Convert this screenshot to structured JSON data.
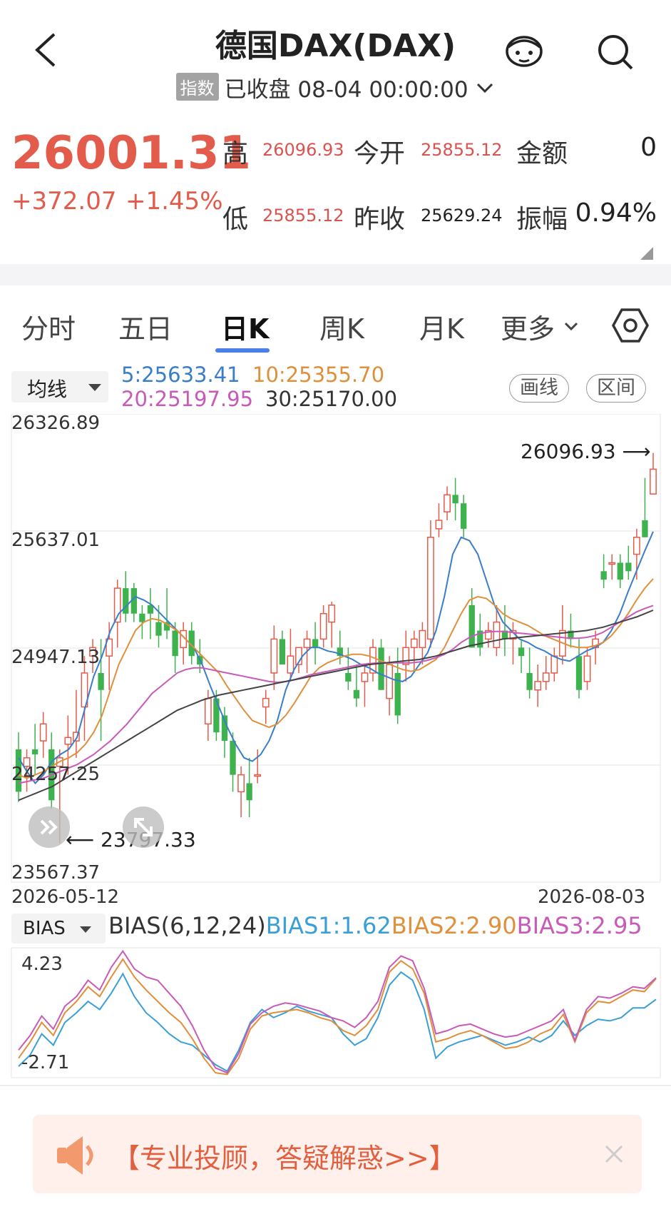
{
  "header": {
    "title": "德国DAX(DAX)",
    "tag": "指数",
    "status": "已收盘",
    "datetime": "08-04 00:00:00"
  },
  "quote": {
    "price": "26001.31",
    "change": "+372.07",
    "change_pct": "+1.45%",
    "high_label": "高",
    "high": "26096.93",
    "low_label": "低",
    "low": "25855.12",
    "open_label": "今开",
    "open": "25855.12",
    "prev_close_label": "昨收",
    "prev_close": "25629.24",
    "amount_label": "金额",
    "amount": "0",
    "amplitude_label": "振幅",
    "amplitude": "0.94%"
  },
  "tabs": [
    "分时",
    "五日",
    "日K",
    "周K",
    "月K",
    "更多"
  ],
  "active_tab": 2,
  "indicator_select": "均线",
  "ma_values": {
    "ma5": "5:25633.41",
    "ma10": "10:25355.70",
    "ma20": "20:25197.95",
    "ma30": "30:25170.00"
  },
  "tools": {
    "draw": "画线",
    "range": "区间"
  },
  "colors": {
    "up": "#e35b4b",
    "down": "#3db24f",
    "ma5": "#3a7dc9",
    "ma10": "#e08f3b",
    "ma20": "#c85ab8",
    "ma30": "#444444"
  },
  "chart_data": [
    {
      "type": "candlestick",
      "y_axis_labels": [
        "26326.89",
        "25637.01",
        "24947.13",
        "24257.25",
        "23567.37"
      ],
      "ylim": [
        23567.37,
        26326.89
      ],
      "x_start": "2026-05-12",
      "x_end": "2026-08-03",
      "max_marker": "26096.93",
      "min_marker": "23797.33",
      "grid": true,
      "candles": [
        {
          "o": 24350,
          "h": 24450,
          "l": 24040,
          "c": 24100
        },
        {
          "o": 24250,
          "h": 24350,
          "l": 24100,
          "c": 24300
        },
        {
          "o": 24350,
          "h": 24500,
          "l": 24200,
          "c": 24320
        },
        {
          "o": 24400,
          "h": 24570,
          "l": 24300,
          "c": 24500
        },
        {
          "o": 24350,
          "h": 24450,
          "l": 24000,
          "c": 24050
        },
        {
          "o": 24250,
          "h": 24350,
          "l": 23797.33,
          "c": 24300
        },
        {
          "o": 24380,
          "h": 24550,
          "l": 24200,
          "c": 24420
        },
        {
          "o": 24400,
          "h": 24700,
          "l": 24300,
          "c": 24450
        },
        {
          "o": 24600,
          "h": 24900,
          "l": 24400,
          "c": 24800
        },
        {
          "o": 24900,
          "h": 25000,
          "l": 24800,
          "c": 24950
        },
        {
          "o": 24800,
          "h": 25000,
          "l": 24400,
          "c": 24700
        },
        {
          "o": 24900,
          "h": 25100,
          "l": 24700,
          "c": 25000
        },
        {
          "o": 25100,
          "h": 25350,
          "l": 24950,
          "c": 25300
        },
        {
          "o": 25300,
          "h": 25400,
          "l": 25100,
          "c": 25150
        },
        {
          "o": 25300,
          "h": 25330,
          "l": 25100,
          "c": 25150
        },
        {
          "o": 25150,
          "h": 25200,
          "l": 25000,
          "c": 25100
        },
        {
          "o": 25200,
          "h": 25300,
          "l": 25000,
          "c": 25150
        },
        {
          "o": 25100,
          "h": 25200,
          "l": 24950,
          "c": 25020
        },
        {
          "o": 25100,
          "h": 25300,
          "l": 25000,
          "c": 25050
        },
        {
          "o": 25050,
          "h": 25100,
          "l": 24800,
          "c": 24900
        },
        {
          "o": 24950,
          "h": 25100,
          "l": 24850,
          "c": 25050
        },
        {
          "o": 25050,
          "h": 25100,
          "l": 24850,
          "c": 24900
        },
        {
          "o": 24900,
          "h": 25000,
          "l": 24800,
          "c": 24850
        },
        {
          "o": 24500,
          "h": 24700,
          "l": 24400,
          "c": 24650
        },
        {
          "o": 24650,
          "h": 24700,
          "l": 24400,
          "c": 24450
        },
        {
          "o": 24550,
          "h": 24600,
          "l": 24300,
          "c": 24400
        },
        {
          "o": 24400,
          "h": 24450,
          "l": 24100,
          "c": 24200
        },
        {
          "o": 24100,
          "h": 24250,
          "l": 23950,
          "c": 24200
        },
        {
          "o": 24150,
          "h": 24300,
          "l": 23950,
          "c": 24050
        },
        {
          "o": 24200,
          "h": 24350,
          "l": 24150,
          "c": 24200
        },
        {
          "o": 24600,
          "h": 24700,
          "l": 24500,
          "c": 24650
        },
        {
          "o": 24800,
          "h": 25080,
          "l": 24700,
          "c": 25000
        },
        {
          "o": 25000,
          "h": 25050,
          "l": 24850,
          "c": 24850
        },
        {
          "o": 24800,
          "h": 25060,
          "l": 24750,
          "c": 24900
        },
        {
          "o": 24850,
          "h": 24950,
          "l": 24800,
          "c": 24950
        },
        {
          "o": 24950,
          "h": 25050,
          "l": 24800,
          "c": 25000
        },
        {
          "o": 25000,
          "h": 25100,
          "l": 24850,
          "c": 24950
        },
        {
          "o": 25000,
          "h": 25200,
          "l": 24950,
          "c": 25150
        },
        {
          "o": 25100,
          "h": 25220,
          "l": 24950,
          "c": 25200
        },
        {
          "o": 24950,
          "h": 25050,
          "l": 24850,
          "c": 24900
        },
        {
          "o": 24800,
          "h": 24950,
          "l": 24700,
          "c": 24750
        },
        {
          "o": 24700,
          "h": 24850,
          "l": 24600,
          "c": 24650
        },
        {
          "o": 24750,
          "h": 24850,
          "l": 24600,
          "c": 24800
        },
        {
          "o": 24800,
          "h": 25000,
          "l": 24750,
          "c": 24950
        },
        {
          "o": 24950,
          "h": 25000,
          "l": 24700,
          "c": 24700
        },
        {
          "o": 24650,
          "h": 24900,
          "l": 24550,
          "c": 24850
        },
        {
          "o": 24800,
          "h": 24950,
          "l": 24500,
          "c": 24550
        },
        {
          "o": 24850,
          "h": 25050,
          "l": 24750,
          "c": 24950
        },
        {
          "o": 24950,
          "h": 25050,
          "l": 24800,
          "c": 25000
        },
        {
          "o": 24950,
          "h": 25100,
          "l": 24850,
          "c": 25050
        },
        {
          "o": 25000,
          "h": 25700,
          "l": 24950,
          "c": 25600
        },
        {
          "o": 25650,
          "h": 25800,
          "l": 25600,
          "c": 25700
        },
        {
          "o": 25750,
          "h": 25900,
          "l": 25700,
          "c": 25850
        },
        {
          "o": 25850,
          "h": 25950,
          "l": 25700,
          "c": 25800
        },
        {
          "o": 25800,
          "h": 25850,
          "l": 25600,
          "c": 25650
        },
        {
          "o": 25200,
          "h": 25300,
          "l": 24950,
          "c": 24950
        },
        {
          "o": 25050,
          "h": 25150,
          "l": 24900,
          "c": 24950
        },
        {
          "o": 25000,
          "h": 25100,
          "l": 24950,
          "c": 25050
        },
        {
          "o": 24950,
          "h": 25200,
          "l": 24900,
          "c": 25100
        },
        {
          "o": 25050,
          "h": 25200,
          "l": 24900,
          "c": 25000
        },
        {
          "o": 25000,
          "h": 25100,
          "l": 24850,
          "c": 25050
        },
        {
          "o": 24950,
          "h": 25000,
          "l": 24800,
          "c": 24900
        },
        {
          "o": 24800,
          "h": 24950,
          "l": 24650,
          "c": 24700
        },
        {
          "o": 24700,
          "h": 24850,
          "l": 24600,
          "c": 24750
        },
        {
          "o": 24750,
          "h": 24900,
          "l": 24700,
          "c": 24800
        },
        {
          "o": 24800,
          "h": 24950,
          "l": 24750,
          "c": 24900
        },
        {
          "o": 24900,
          "h": 25200,
          "l": 24850,
          "c": 25050
        },
        {
          "o": 25050,
          "h": 25150,
          "l": 24950,
          "c": 25000
        },
        {
          "o": 24900,
          "h": 25000,
          "l": 24650,
          "c": 24700
        },
        {
          "o": 24750,
          "h": 24950,
          "l": 24700,
          "c": 24900
        },
        {
          "o": 24950,
          "h": 25050,
          "l": 24850,
          "c": 25000
        },
        {
          "o": 25400,
          "h": 25500,
          "l": 25300,
          "c": 25350
        },
        {
          "o": 25450,
          "h": 25500,
          "l": 25350,
          "c": 25450
        },
        {
          "o": 25450,
          "h": 25500,
          "l": 25300,
          "c": 25350
        },
        {
          "o": 25450,
          "h": 25550,
          "l": 25350,
          "c": 25400
        },
        {
          "o": 25500,
          "h": 25650,
          "l": 25350,
          "c": 25600
        },
        {
          "o": 25700,
          "h": 25950,
          "l": 25600,
          "c": 25600
        },
        {
          "o": 25855.12,
          "h": 26096.93,
          "l": 25855.12,
          "c": 26001.31
        }
      ],
      "ma_lines": [
        {
          "name": "5",
          "color": "#3a7dc9",
          "values": [
            24300,
            24220,
            24150,
            24200,
            24280,
            24320,
            24350,
            24420,
            24600,
            24780,
            24900,
            25050,
            25150,
            25200,
            25250,
            25230,
            25200,
            25150,
            25100,
            25050,
            25000,
            24950,
            24850,
            24720,
            24600,
            24480,
            24380,
            24300,
            24280,
            24320,
            24400,
            24520,
            24700,
            24820,
            24900,
            24950,
            24950,
            24930,
            24920,
            24900,
            24880,
            24850,
            24830,
            24800,
            24780,
            24760,
            24750,
            24780,
            24850,
            24920,
            25050,
            25250,
            25500,
            25600,
            25580,
            25500,
            25350,
            25200,
            25100,
            25050,
            25000,
            24980,
            24950,
            24930,
            24900,
            24880,
            24870,
            24900,
            24930,
            24950,
            24980,
            25050,
            25150,
            25280,
            25400,
            25520,
            25633.41
          ]
        },
        {
          "name": "10",
          "color": "#e08f3b",
          "values": [
            24200,
            24180,
            24200,
            24220,
            24250,
            24280,
            24300,
            24330,
            24380,
            24450,
            24550,
            24700,
            24850,
            24950,
            25050,
            25100,
            25120,
            25110,
            25080,
            25050,
            25000,
            24950,
            24900,
            24850,
            24800,
            24720,
            24650,
            24580,
            24520,
            24500,
            24480,
            24500,
            24550,
            24620,
            24700,
            24780,
            24830,
            24860,
            24880,
            24900,
            24910,
            24910,
            24900,
            24880,
            24860,
            24840,
            24820,
            24810,
            24820,
            24850,
            24880,
            24950,
            25050,
            25150,
            25230,
            25250,
            25240,
            25200,
            25150,
            25120,
            25100,
            25080,
            25050,
            25020,
            25000,
            24980,
            24960,
            24950,
            24950,
            24960,
            24980,
            25020,
            25080,
            25150,
            25230,
            25300,
            25355.7
          ]
        },
        {
          "name": "20",
          "color": "#c85ab8",
          "values": [
            24150,
            24160,
            24170,
            24180,
            24200,
            24220,
            24240,
            24260,
            24290,
            24320,
            24360,
            24400,
            24450,
            24500,
            24560,
            24620,
            24680,
            24720,
            24760,
            24800,
            24820,
            24830,
            24830,
            24820,
            24810,
            24800,
            24790,
            24780,
            24770,
            24760,
            24750,
            24745,
            24750,
            24760,
            24775,
            24790,
            24800,
            24810,
            24820,
            24830,
            24840,
            24850,
            24855,
            24860,
            24860,
            24860,
            24860,
            24860,
            24865,
            24875,
            24890,
            24910,
            24940,
            24980,
            25010,
            25030,
            25040,
            25045,
            25045,
            25040,
            25035,
            25030,
            25025,
            25020,
            25015,
            25010,
            25005,
            25005,
            25010,
            25020,
            25040,
            25070,
            25100,
            25130,
            25160,
            25180,
            25197.95
          ]
        },
        {
          "name": "30",
          "color": "#444444",
          "values": [
            24050,
            24070,
            24090,
            24110,
            24130,
            24160,
            24190,
            24220,
            24250,
            24280,
            24310,
            24340,
            24370,
            24400,
            24430,
            24460,
            24490,
            24520,
            24550,
            24580,
            24600,
            24620,
            24640,
            24655,
            24670,
            24680,
            24690,
            24700,
            24710,
            24720,
            24730,
            24740,
            24750,
            24760,
            24770,
            24780,
            24790,
            24800,
            24810,
            24820,
            24830,
            24840,
            24850,
            24855,
            24860,
            24865,
            24870,
            24875,
            24880,
            24890,
            24900,
            24915,
            24930,
            24945,
            24960,
            24970,
            24980,
            24990,
            25000,
            25005,
            25010,
            25015,
            25020,
            25025,
            25030,
            25035,
            25040,
            25045,
            25050,
            25060,
            25070,
            25085,
            25100,
            25115,
            25130,
            25150,
            25170.0
          ]
        }
      ]
    },
    {
      "type": "line",
      "title": "BIAS(6,12,24)",
      "y_axis_labels": [
        "4.23",
        "-2.71"
      ],
      "ylim": [
        -3.2,
        4.8
      ],
      "series": [
        {
          "name": "BIAS1:1.62",
          "color": "#3a9fd6",
          "values": [
            -2.5,
            -1.8,
            -0.5,
            -1.2,
            0.2,
            0.8,
            1.5,
            1.0,
            2.0,
            3.2,
            1.8,
            0.8,
            0.2,
            -0.5,
            -1.0,
            -1.2,
            -1.8,
            -2.4,
            -2.8,
            -1.5,
            0.2,
            1.0,
            0.5,
            0.8,
            1.2,
            0.9,
            0.7,
            0.5,
            -0.5,
            -1.2,
            -0.8,
            0.5,
            2.5,
            3.3,
            2.8,
            1.0,
            -2.0,
            -1.3,
            -1.0,
            -0.8,
            -0.6,
            -0.9,
            -1.2,
            -1.0,
            -0.7,
            -1.0,
            -0.6,
            0.3,
            -0.6,
            0.0,
            0.4,
            0.3,
            0.5,
            1.1,
            1.1,
            1.62
          ]
        },
        {
          "name": "BIAS2:2.90",
          "color": "#e08f3b",
          "values": [
            -2.0,
            -1.0,
            0.2,
            -0.6,
            0.8,
            1.5,
            2.4,
            1.8,
            3.0,
            4.1,
            3.0,
            2.2,
            1.5,
            0.8,
            0.2,
            -0.8,
            -2.0,
            -2.9,
            -3.0,
            -2.0,
            -0.2,
            0.6,
            0.8,
            0.9,
            1.0,
            0.8,
            0.5,
            0.3,
            -0.3,
            -0.6,
            0.0,
            1.0,
            3.3,
            4.0,
            3.5,
            2.0,
            -1.0,
            -0.8,
            -0.5,
            -0.3,
            -0.6,
            -1.0,
            -1.4,
            -1.3,
            -1.0,
            -0.5,
            -0.2,
            0.7,
            -1.0,
            0.8,
            1.5,
            1.4,
            1.8,
            2.2,
            2.1,
            2.9
          ]
        },
        {
          "name": "BIAS3:2.95",
          "color": "#c85ab8",
          "values": [
            -1.5,
            -0.6,
            0.6,
            -0.2,
            1.2,
            1.8,
            2.8,
            2.2,
            3.6,
            4.6,
            3.5,
            3.0,
            2.8,
            2.0,
            1.2,
            0.0,
            -1.5,
            -2.6,
            -2.9,
            -1.7,
            0.1,
            0.8,
            1.2,
            1.4,
            1.3,
            1.1,
            0.9,
            0.5,
            0.3,
            -0.1,
            0.5,
            1.5,
            3.6,
            4.3,
            4.0,
            2.3,
            -0.5,
            -0.3,
            0.0,
            0.1,
            -0.2,
            -0.5,
            -0.7,
            -0.6,
            -0.3,
            0.0,
            0.3,
            1.0,
            -0.9,
            1.0,
            1.8,
            1.7,
            2.0,
            2.4,
            2.3,
            2.95
          ]
        }
      ]
    }
  ],
  "bias_select": "BIAS",
  "banner": {
    "text": "【专业投顾，答疑解惑>>】"
  }
}
